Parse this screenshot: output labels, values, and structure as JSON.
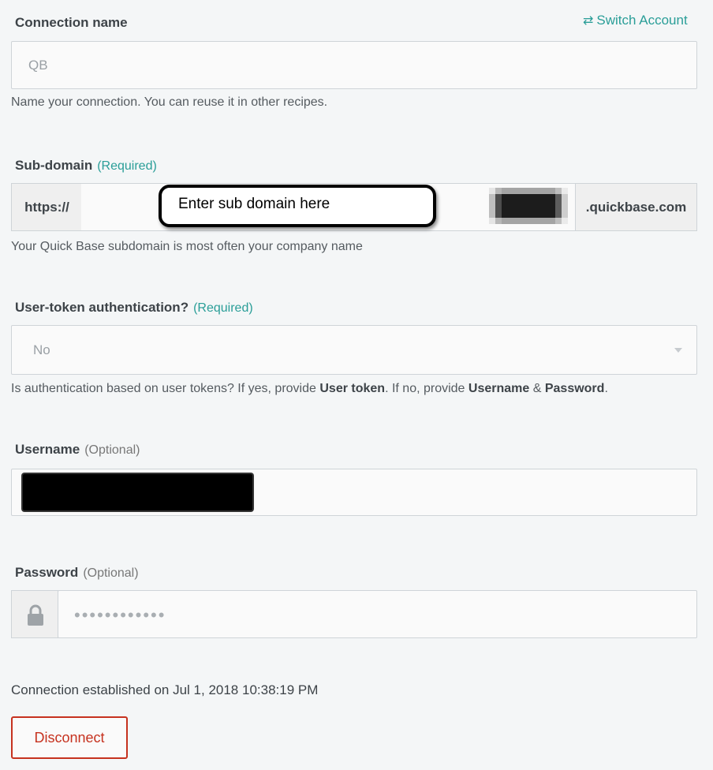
{
  "header": {
    "switch_account": "Switch Account"
  },
  "connection_name": {
    "label": "Connection name",
    "placeholder": "QB",
    "hint": "Name your connection. You can reuse it in other recipes."
  },
  "subdomain": {
    "label": "Sub-domain",
    "required": "(Required)",
    "prefix": "https://",
    "suffix": ".quickbase.com",
    "callout": "Enter sub domain here",
    "hint": "Your Quick Base subdomain is most often your company name"
  },
  "token_auth": {
    "label": "User-token authentication?",
    "required": "(Required)",
    "value": "No",
    "hint_parts": [
      "Is authentication based on user tokens? If yes, provide ",
      "User token",
      ". If no, provide ",
      "Username",
      " & ",
      "Password",
      "."
    ]
  },
  "username": {
    "label": "Username",
    "optional": "(Optional)"
  },
  "password": {
    "label": "Password",
    "optional": "(Optional)",
    "masked_value": "••••••••••••"
  },
  "status": {
    "established": "Connection established on Jul 1, 2018 10:38:19 PM"
  },
  "actions": {
    "disconnect": "Disconnect"
  },
  "colors": {
    "accent": "#2a9e98",
    "danger": "#c6321f"
  },
  "icons": {
    "switch": "swap-arrows-icon",
    "lock": "lock-icon",
    "caret": "chevron-down-icon"
  }
}
